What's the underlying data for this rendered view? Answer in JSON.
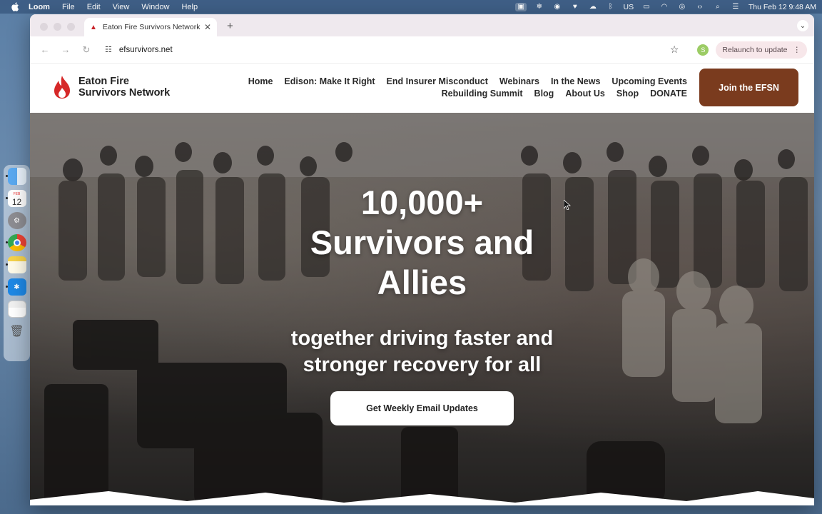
{
  "menubar": {
    "app": "Loom",
    "items": [
      "File",
      "Edit",
      "View",
      "Window",
      "Help"
    ],
    "keyboard": "US",
    "datetime": "Thu Feb 12  9:48 AM"
  },
  "dock": {
    "calendar_month": "FEB",
    "calendar_day": "12"
  },
  "browser": {
    "tab_title": "Eaton Fire Survivors Network",
    "url": "efsurvivors.net",
    "profile_initial": "S",
    "relaunch_label": "Relaunch to update"
  },
  "site": {
    "logo_line1": "Eaton Fire",
    "logo_line2": "Survivors Network",
    "nav_row1": [
      "Home",
      "Edison: Make It Right",
      "End Insurer Misconduct",
      "Webinars",
      "In the News",
      "Upcoming Events"
    ],
    "nav_row2": [
      "Rebuilding Summit",
      "Blog",
      "About Us",
      "Shop",
      "DONATE"
    ],
    "join_label": "Join the EFSN"
  },
  "hero": {
    "line1": "10,000+",
    "line2": "Survivors and",
    "line3": "Allies",
    "sub1": "together driving faster and",
    "sub2": "stronger recovery for all",
    "cta_label": "Get Weekly Email Updates"
  },
  "colors": {
    "join_button": "#7a3b1e",
    "logo_red": "#d62828"
  }
}
